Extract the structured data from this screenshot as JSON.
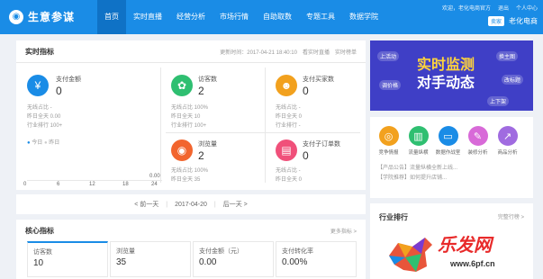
{
  "app": {
    "name": "生意参谋"
  },
  "nav": [
    "首页",
    "实时直播",
    "经营分析",
    "市场行情",
    "自助取数",
    "专题工具",
    "数据学院"
  ],
  "top_right": {
    "line1": [
      "欢迎，老化电商官方",
      "退出",
      "个人中心"
    ],
    "tag": "卖家",
    "shop": "老化电商"
  },
  "realtime": {
    "title": "实时指标",
    "updated": "更新时间：2017-04-21 18:40:10",
    "links": [
      "看实时直播",
      "实时榜单"
    ],
    "metrics": [
      {
        "label": "支付金额",
        "value": "0",
        "sub": [
          "无线占比  -",
          "昨日全天  0.00",
          "行业排行 100+"
        ]
      },
      {
        "label": "访客数",
        "value": "2",
        "sub": [
          "无线占比  100%",
          "昨日全天  10",
          "行业排行 100+"
        ]
      },
      {
        "label": "支付买家数",
        "value": "0",
        "sub": [
          "无线占比  -",
          "昨日全天  0",
          "行业排行 -"
        ]
      },
      {
        "label": "浏览量",
        "value": "2",
        "sub": [
          "无线占比  100%",
          "昨日全天  35"
        ]
      },
      {
        "label": "支付子订单数",
        "value": "0",
        "sub": [
          "无线占比  -",
          "昨日全天  0"
        ]
      }
    ],
    "chart": {
      "legend": [
        "今日",
        "昨日"
      ],
      "x_ticks": [
        "0",
        "6",
        "12",
        "18",
        "24"
      ],
      "y_top": "0.00"
    }
  },
  "date_bar": {
    "prev": "< 前一天",
    "date": "2017-04-20",
    "next": "后一天 >"
  },
  "core": {
    "title": "核心指标",
    "link": "更多指标 >",
    "cards": [
      {
        "label": "访客数",
        "value": "10"
      },
      {
        "label": "浏览量",
        "value": "35"
      },
      {
        "label": "支付金额（元）",
        "value": "0.00"
      },
      {
        "label": "支付转化率",
        "value": "0.00%"
      }
    ]
  },
  "banner": {
    "title1": "实时监测",
    "title2": "对手动态",
    "bubbles": [
      "上活动",
      "换主图",
      "调价格",
      "改标题",
      "上下架"
    ]
  },
  "tools": [
    {
      "label": "竞争情报",
      "color": "#f2a11e",
      "icon": "compass-icon"
    },
    {
      "label": "流量纵横",
      "color": "#2fbf71",
      "icon": "chart-icon"
    },
    {
      "label": "数据作战室",
      "color": "#1a8ce6",
      "icon": "screen-icon"
    },
    {
      "label": "装修分析",
      "color": "#d86ad8",
      "icon": "brush-icon"
    },
    {
      "label": "商品分析",
      "color": "#a06be0",
      "icon": "trend-icon"
    }
  ],
  "news": [
    "【产品公告】流量纵横全新上线...",
    "【学院推荐】如何提升店铺..."
  ],
  "rank": {
    "title": "行业排行",
    "link": "完整行榜 >"
  },
  "watermark": {
    "brand": "乐发网",
    "url": "www.6pf.cn"
  }
}
